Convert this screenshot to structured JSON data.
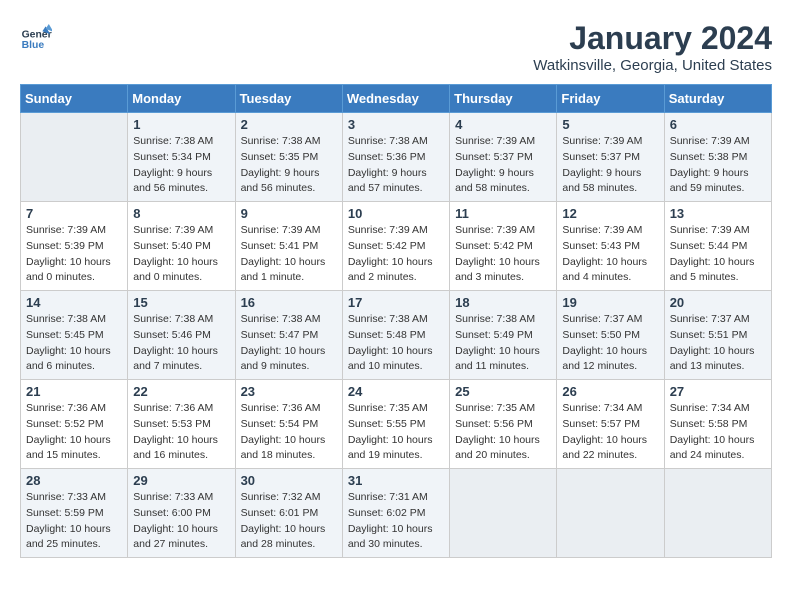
{
  "header": {
    "logo_line1": "General",
    "logo_line2": "Blue",
    "month_year": "January 2024",
    "location": "Watkinsville, Georgia, United States"
  },
  "calendar": {
    "days_of_week": [
      "Sunday",
      "Monday",
      "Tuesday",
      "Wednesday",
      "Thursday",
      "Friday",
      "Saturday"
    ],
    "weeks": [
      [
        {
          "day": "",
          "info": ""
        },
        {
          "day": "1",
          "info": "Sunrise: 7:38 AM\nSunset: 5:34 PM\nDaylight: 9 hours\nand 56 minutes."
        },
        {
          "day": "2",
          "info": "Sunrise: 7:38 AM\nSunset: 5:35 PM\nDaylight: 9 hours\nand 56 minutes."
        },
        {
          "day": "3",
          "info": "Sunrise: 7:38 AM\nSunset: 5:36 PM\nDaylight: 9 hours\nand 57 minutes."
        },
        {
          "day": "4",
          "info": "Sunrise: 7:39 AM\nSunset: 5:37 PM\nDaylight: 9 hours\nand 58 minutes."
        },
        {
          "day": "5",
          "info": "Sunrise: 7:39 AM\nSunset: 5:37 PM\nDaylight: 9 hours\nand 58 minutes."
        },
        {
          "day": "6",
          "info": "Sunrise: 7:39 AM\nSunset: 5:38 PM\nDaylight: 9 hours\nand 59 minutes."
        }
      ],
      [
        {
          "day": "7",
          "info": "Sunrise: 7:39 AM\nSunset: 5:39 PM\nDaylight: 10 hours\nand 0 minutes."
        },
        {
          "day": "8",
          "info": "Sunrise: 7:39 AM\nSunset: 5:40 PM\nDaylight: 10 hours\nand 0 minutes."
        },
        {
          "day": "9",
          "info": "Sunrise: 7:39 AM\nSunset: 5:41 PM\nDaylight: 10 hours\nand 1 minute."
        },
        {
          "day": "10",
          "info": "Sunrise: 7:39 AM\nSunset: 5:42 PM\nDaylight: 10 hours\nand 2 minutes."
        },
        {
          "day": "11",
          "info": "Sunrise: 7:39 AM\nSunset: 5:42 PM\nDaylight: 10 hours\nand 3 minutes."
        },
        {
          "day": "12",
          "info": "Sunrise: 7:39 AM\nSunset: 5:43 PM\nDaylight: 10 hours\nand 4 minutes."
        },
        {
          "day": "13",
          "info": "Sunrise: 7:39 AM\nSunset: 5:44 PM\nDaylight: 10 hours\nand 5 minutes."
        }
      ],
      [
        {
          "day": "14",
          "info": "Sunrise: 7:38 AM\nSunset: 5:45 PM\nDaylight: 10 hours\nand 6 minutes."
        },
        {
          "day": "15",
          "info": "Sunrise: 7:38 AM\nSunset: 5:46 PM\nDaylight: 10 hours\nand 7 minutes."
        },
        {
          "day": "16",
          "info": "Sunrise: 7:38 AM\nSunset: 5:47 PM\nDaylight: 10 hours\nand 9 minutes."
        },
        {
          "day": "17",
          "info": "Sunrise: 7:38 AM\nSunset: 5:48 PM\nDaylight: 10 hours\nand 10 minutes."
        },
        {
          "day": "18",
          "info": "Sunrise: 7:38 AM\nSunset: 5:49 PM\nDaylight: 10 hours\nand 11 minutes."
        },
        {
          "day": "19",
          "info": "Sunrise: 7:37 AM\nSunset: 5:50 PM\nDaylight: 10 hours\nand 12 minutes."
        },
        {
          "day": "20",
          "info": "Sunrise: 7:37 AM\nSunset: 5:51 PM\nDaylight: 10 hours\nand 13 minutes."
        }
      ],
      [
        {
          "day": "21",
          "info": "Sunrise: 7:36 AM\nSunset: 5:52 PM\nDaylight: 10 hours\nand 15 minutes."
        },
        {
          "day": "22",
          "info": "Sunrise: 7:36 AM\nSunset: 5:53 PM\nDaylight: 10 hours\nand 16 minutes."
        },
        {
          "day": "23",
          "info": "Sunrise: 7:36 AM\nSunset: 5:54 PM\nDaylight: 10 hours\nand 18 minutes."
        },
        {
          "day": "24",
          "info": "Sunrise: 7:35 AM\nSunset: 5:55 PM\nDaylight: 10 hours\nand 19 minutes."
        },
        {
          "day": "25",
          "info": "Sunrise: 7:35 AM\nSunset: 5:56 PM\nDaylight: 10 hours\nand 20 minutes."
        },
        {
          "day": "26",
          "info": "Sunrise: 7:34 AM\nSunset: 5:57 PM\nDaylight: 10 hours\nand 22 minutes."
        },
        {
          "day": "27",
          "info": "Sunrise: 7:34 AM\nSunset: 5:58 PM\nDaylight: 10 hours\nand 24 minutes."
        }
      ],
      [
        {
          "day": "28",
          "info": "Sunrise: 7:33 AM\nSunset: 5:59 PM\nDaylight: 10 hours\nand 25 minutes."
        },
        {
          "day": "29",
          "info": "Sunrise: 7:33 AM\nSunset: 6:00 PM\nDaylight: 10 hours\nand 27 minutes."
        },
        {
          "day": "30",
          "info": "Sunrise: 7:32 AM\nSunset: 6:01 PM\nDaylight: 10 hours\nand 28 minutes."
        },
        {
          "day": "31",
          "info": "Sunrise: 7:31 AM\nSunset: 6:02 PM\nDaylight: 10 hours\nand 30 minutes."
        },
        {
          "day": "",
          "info": ""
        },
        {
          "day": "",
          "info": ""
        },
        {
          "day": "",
          "info": ""
        }
      ]
    ]
  }
}
